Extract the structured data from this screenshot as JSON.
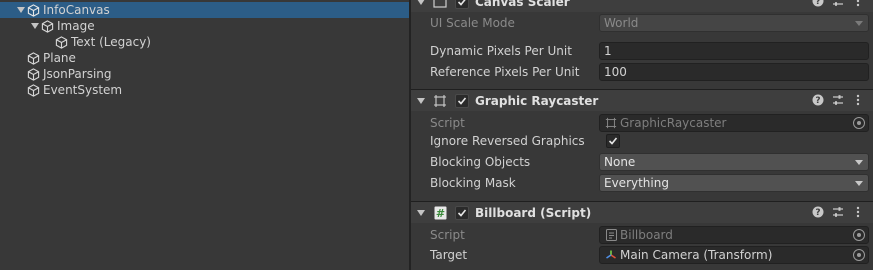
{
  "hierarchy": {
    "items": [
      {
        "label": "InfoCanvas",
        "expanded": true,
        "selected": true
      },
      {
        "label": "Image",
        "expanded": true
      },
      {
        "label": "Text (Legacy)"
      },
      {
        "label": "Plane"
      },
      {
        "label": "JsonParsing"
      },
      {
        "label": "EventSystem"
      }
    ]
  },
  "inspector": {
    "canvas_scaler": {
      "title": "Canvas Scaler",
      "ui_scale_mode_label": "UI Scale Mode",
      "ui_scale_mode_value": "World",
      "dynamic_pixels_label": "Dynamic Pixels Per Unit",
      "dynamic_pixels_value": "1",
      "reference_pixels_label": "Reference Pixels Per Unit",
      "reference_pixels_value": "100"
    },
    "graphic_raycaster": {
      "title": "Graphic Raycaster",
      "script_label": "Script",
      "script_value": "GraphicRaycaster",
      "ignore_reversed_label": "Ignore Reversed Graphics",
      "ignore_reversed_checked": true,
      "blocking_objects_label": "Blocking Objects",
      "blocking_objects_value": "None",
      "blocking_mask_label": "Blocking Mask",
      "blocking_mask_value": "Everything"
    },
    "billboard": {
      "title": "Billboard (Script)",
      "script_label": "Script",
      "script_value": "Billboard",
      "target_label": "Target",
      "target_value": "Main Camera (Transform)"
    }
  },
  "colors": {
    "selection": "#2c5d87",
    "panel": "#383838",
    "header": "#3e3e3e",
    "field": "#2a2a2a"
  },
  "icons": {
    "gameobject": "cube-icon",
    "graphic_raycaster": "rect-transform-icon",
    "billboard": "script-hash-icon",
    "help": "help-icon",
    "presets": "sliders-icon",
    "menu": "kebab-menu-icon"
  }
}
